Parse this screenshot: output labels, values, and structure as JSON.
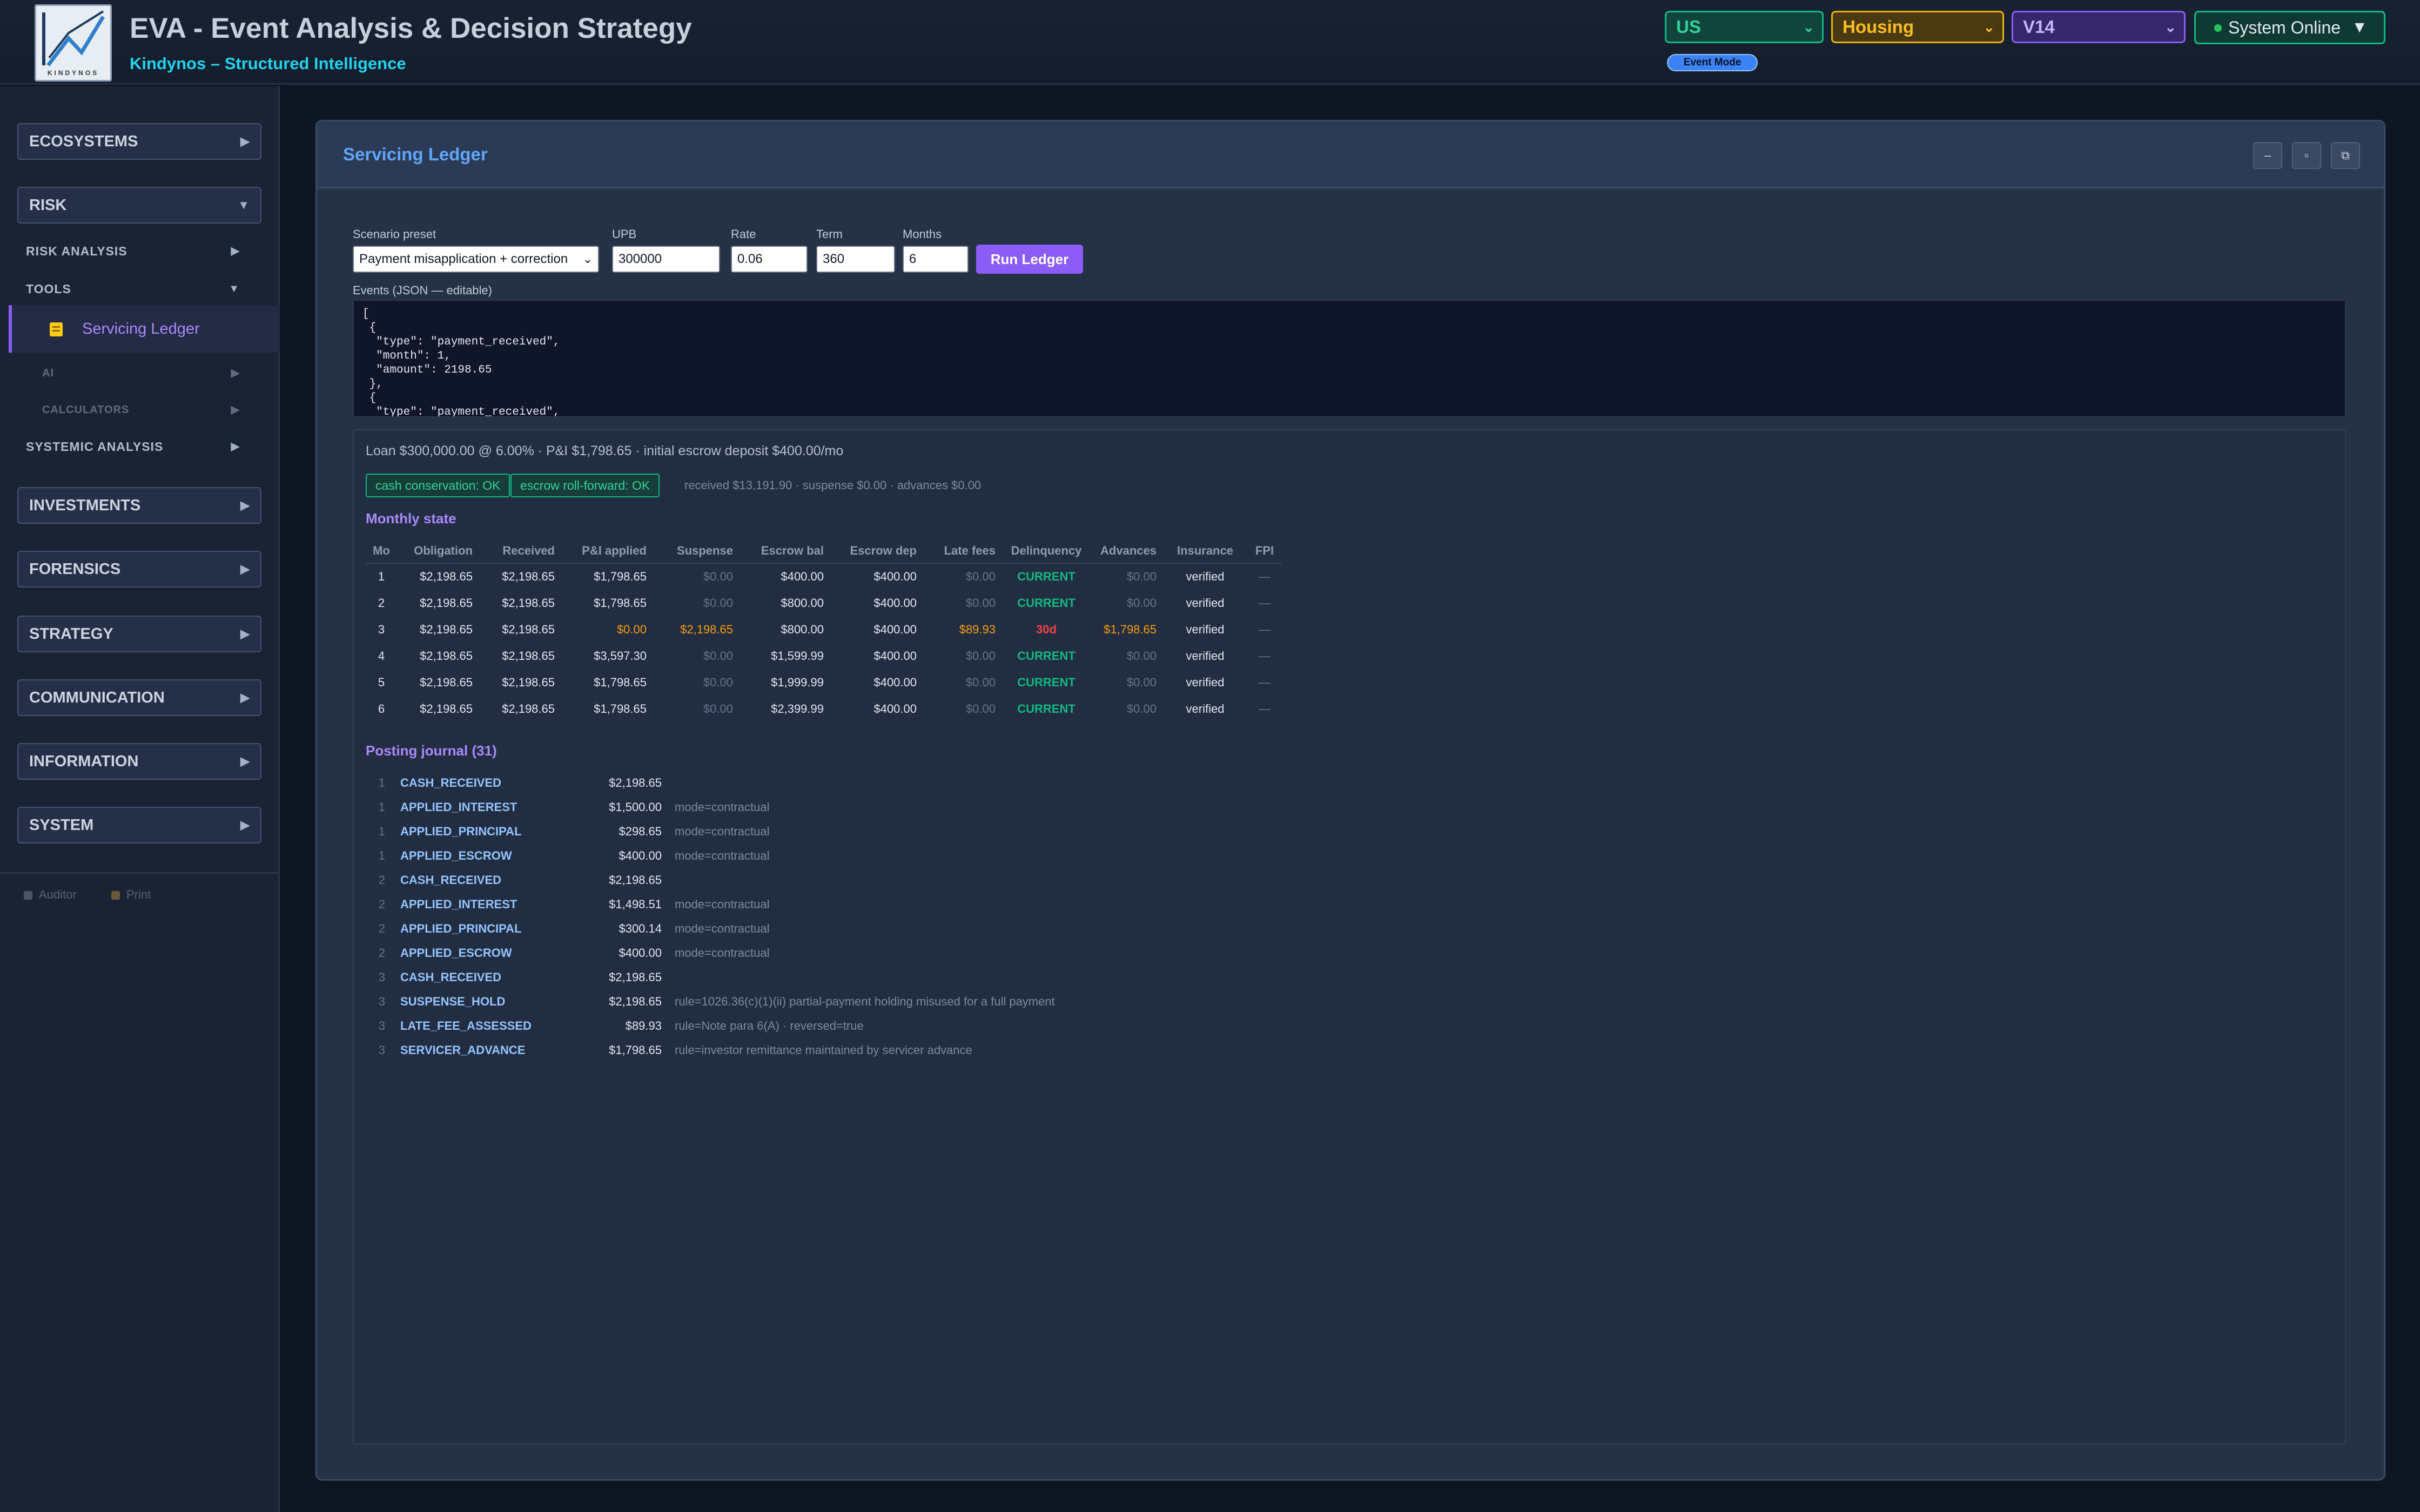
{
  "header": {
    "title": "EVA - Event Analysis & Decision Strategy",
    "subtitle": "Kindynos – Structured Intelligence",
    "logo_word": "KINDYNOS",
    "country": "US",
    "sector": "Housing",
    "version": "V14",
    "status": "System Online",
    "mode_badge": "Event Mode"
  },
  "sidebar": {
    "sections": {
      "ecosystems": "ECOSYSTEMS",
      "risk": "RISK",
      "investments": "INVESTMENTS",
      "forensics": "FORENSICS",
      "strategy": "STRATEGY",
      "communication": "COMMUNICATION",
      "information": "INFORMATION",
      "system": "SYSTEM"
    },
    "risk_items": {
      "risk_analysis": "RISK ANALYSIS",
      "tools": "TOOLS",
      "servicing_ledger": "Servicing Ledger",
      "ai": "AI",
      "calculators": "CALCULATORS",
      "systemic_analysis": "SYSTEMIC ANALYSIS"
    },
    "footer": {
      "auditor": "Auditor",
      "print": "Print"
    }
  },
  "panel": {
    "title": "Servicing Ledger",
    "form": {
      "preset_label": "Scenario preset",
      "preset_value": "Payment misapplication + correction",
      "upb_label": "UPB",
      "upb_value": "300000",
      "rate_label": "Rate",
      "rate_value": "0.06",
      "term_label": "Term",
      "term_value": "360",
      "months_label": "Months",
      "months_value": "6",
      "run_button": "Run Ledger",
      "events_label": "Events (JSON — editable)",
      "events_text": "[\n {\n  \"type\": \"payment_received\",\n  \"month\": 1,\n  \"amount\": 2198.65\n },\n {\n  \"type\": \"payment_received\","
    },
    "results": {
      "loan_summary": "Loan $300,000.00 @ 6.00% · P&I $1,798.65 · initial escrow deposit $400.00/mo",
      "badge_cash": "cash conservation: OK",
      "badge_escrow": "escrow roll-forward: OK",
      "totals_note": "received $13,191.90 · suspense $0.00 · advances $0.00",
      "monthly_heading": "Monthly state",
      "columns": [
        "Mo",
        "Obligation",
        "Received",
        "P&I applied",
        "Suspense",
        "Escrow bal",
        "Escrow dep",
        "Late fees",
        "Delinquency",
        "Advances",
        "Insurance",
        "FPI"
      ],
      "rows": [
        [
          "1",
          "$2,198.65",
          "$2,198.65",
          "$1,798.65",
          "$0.00",
          "$400.00",
          "$400.00",
          "$0.00",
          "CURRENT",
          "$0.00",
          "verified",
          "—"
        ],
        [
          "2",
          "$2,198.65",
          "$2,198.65",
          "$1,798.65",
          "$0.00",
          "$800.00",
          "$400.00",
          "$0.00",
          "CURRENT",
          "$0.00",
          "verified",
          "—"
        ],
        [
          "3",
          "$2,198.65",
          "$2,198.65",
          "$0.00",
          "$2,198.65",
          "$800.00",
          "$400.00",
          "$89.93",
          "30d",
          "$1,798.65",
          "verified",
          "—"
        ],
        [
          "4",
          "$2,198.65",
          "$2,198.65",
          "$3,597.30",
          "$0.00",
          "$1,599.99",
          "$400.00",
          "$0.00",
          "CURRENT",
          "$0.00",
          "verified",
          "—"
        ],
        [
          "5",
          "$2,198.65",
          "$2,198.65",
          "$1,798.65",
          "$0.00",
          "$1,999.99",
          "$400.00",
          "$0.00",
          "CURRENT",
          "$0.00",
          "verified",
          "—"
        ],
        [
          "6",
          "$2,198.65",
          "$2,198.65",
          "$1,798.65",
          "$0.00",
          "$2,399.99",
          "$400.00",
          "$0.00",
          "CURRENT",
          "$0.00",
          "verified",
          "—"
        ]
      ],
      "journal_heading": "Posting journal (31)",
      "journal": [
        [
          "1",
          "CASH_RECEIVED",
          "$2,198.65",
          ""
        ],
        [
          "1",
          "APPLIED_INTEREST",
          "$1,500.00",
          "mode=contractual"
        ],
        [
          "1",
          "APPLIED_PRINCIPAL",
          "$298.65",
          "mode=contractual"
        ],
        [
          "1",
          "APPLIED_ESCROW",
          "$400.00",
          "mode=contractual"
        ],
        [
          "2",
          "CASH_RECEIVED",
          "$2,198.65",
          ""
        ],
        [
          "2",
          "APPLIED_INTEREST",
          "$1,498.51",
          "mode=contractual"
        ],
        [
          "2",
          "APPLIED_PRINCIPAL",
          "$300.14",
          "mode=contractual"
        ],
        [
          "2",
          "APPLIED_ESCROW",
          "$400.00",
          "mode=contractual"
        ],
        [
          "3",
          "CASH_RECEIVED",
          "$2,198.65",
          ""
        ],
        [
          "3",
          "SUSPENSE_HOLD",
          "$2,198.65",
          "rule=1026.36(c)(1)(ii) partial-payment holding misused for a full payment"
        ],
        [
          "3",
          "LATE_FEE_ASSESSED",
          "$89.93",
          "rule=Note para 6(A) · reversed=true"
        ],
        [
          "3",
          "SERVICER_ADVANCE",
          "$1,798.65",
          "rule=investor remittance maintained by servicer advance"
        ]
      ]
    }
  }
}
